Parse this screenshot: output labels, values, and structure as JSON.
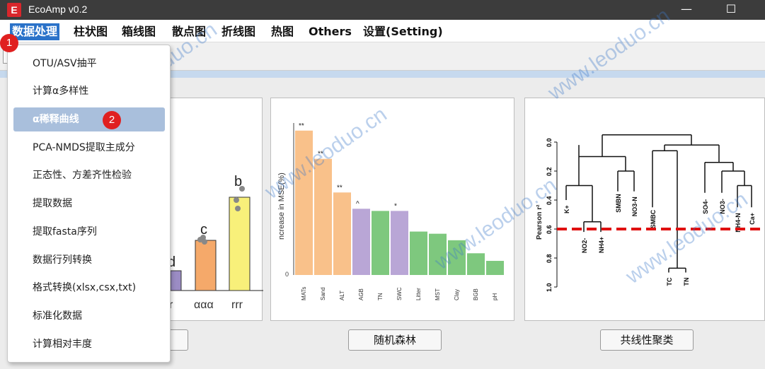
{
  "app": {
    "title": "EcoAmp v0.2",
    "logo_letter": "E"
  },
  "window_controls": {
    "minimize": "—",
    "maximize": "☐"
  },
  "menubar": [
    {
      "label": "数据处理"
    },
    {
      "label": "柱状图"
    },
    {
      "label": "箱线图"
    },
    {
      "label": "散点图"
    },
    {
      "label": "折线图"
    },
    {
      "label": "热图"
    },
    {
      "label": "Others"
    },
    {
      "label": "设置(Setting)"
    }
  ],
  "dropdown": [
    {
      "label": "OTU/ASV抽平"
    },
    {
      "label": "计算α多样性"
    },
    {
      "label": "α稀释曲线"
    },
    {
      "label": "PCA-NMDS提取主成分"
    },
    {
      "label": "正态性、方差齐性检验"
    },
    {
      "label": "提取数据"
    },
    {
      "label": "提取fasta序列"
    },
    {
      "label": "数据行列转换"
    },
    {
      "label": "格式转换(xlsx,csx,txt)"
    },
    {
      "label": "标准化数据"
    },
    {
      "label": "计算相对丰度"
    }
  ],
  "badges": {
    "one": "1",
    "two": "2"
  },
  "buttons": {
    "random_forest": "随机森林",
    "collinearity": "共线性聚类"
  },
  "watermark": "www.leoduo.cn",
  "chart1": {
    "type": "bar",
    "categories": [
      "r",
      "ααα",
      "rrr"
    ],
    "letters": [
      "d",
      "c",
      "b"
    ],
    "colors": [
      "#9b8cc4",
      "#f5a96a",
      "#f8f07a"
    ]
  },
  "chart_data": [
    {
      "type": "bar",
      "ylabel": "ncrease in MSE(%)",
      "categories": [
        "MATs",
        "Sand",
        "ALT",
        "AGB",
        "TN",
        "SWC",
        "Litter",
        "MST",
        "Clay",
        "BGB",
        "pH"
      ],
      "values": [
        13.3,
        10.7,
        7.6,
        6.1,
        5.9,
        5.9,
        4.0,
        3.8,
        3.2,
        2.0,
        1.3
      ],
      "significance": [
        "**",
        "**",
        "**",
        "^",
        "",
        "*",
        "",
        "",
        "",
        "",
        ""
      ],
      "colors": [
        "#f9c18a",
        "#f9c18a",
        "#f9c18a",
        "#b9a6d6",
        "#7ec87e",
        "#b9a6d6",
        "#7ec87e",
        "#7ec87e",
        "#7ec87e",
        "#7ec87e",
        "#7ec87e"
      ],
      "ytick": "0"
    },
    {
      "type": "dendrogram",
      "ylabel": "Pearson r²",
      "yticks": [
        "0.0",
        "0.2",
        "0.4",
        "0.6",
        "0.8",
        "1.0"
      ],
      "leaves": [
        "K+",
        "NO2-",
        "NH4+",
        "SMBN",
        "NO3-N",
        "SMBC",
        "TC",
        "TN",
        "SO4-",
        "NO3-",
        "NH4-N",
        "Ca+"
      ],
      "cut_height": 0.6
    }
  ]
}
